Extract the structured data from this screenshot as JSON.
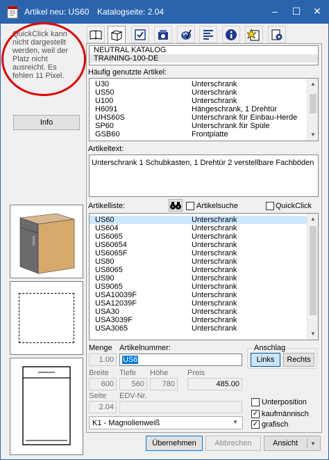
{
  "window": {
    "title": "Artikel neu: US60",
    "catalog_page": "Katalogseite: 2.04",
    "minimize": "–",
    "maximize": "☐",
    "close": "✕"
  },
  "left": {
    "quickclick_message": "QuickClick kann nicht dargestellt werden, weil der Platz nicht ausreicht. Es fehlen 11 Pixel.",
    "info_button": "Info"
  },
  "toolbar": {
    "icons": [
      "book-icon",
      "cube-icon",
      "checkbox-icon",
      "machine-icon",
      "palette-icon",
      "text-align-icon",
      "info-icon",
      "star-note-icon",
      "gear-doc-icon"
    ]
  },
  "catalog": {
    "items": [
      "NEUTRAL KATALOG",
      "TRAINING-100-DE"
    ]
  },
  "frequent": {
    "label": "Häufig genutzte Artikel:",
    "rows": [
      {
        "code": "U30",
        "desc": "Unterschrank"
      },
      {
        "code": "US50",
        "desc": "Unterschrank"
      },
      {
        "code": "U100",
        "desc": "Unterschrank"
      },
      {
        "code": "H6091",
        "desc": "Hängeschrank, 1 Drehtür"
      },
      {
        "code": "UHS60S",
        "desc": "Unterschrank für Einbau-Herde"
      },
      {
        "code": "SP60",
        "desc": "Unterschrank für Spüle"
      },
      {
        "code": "GSB60",
        "desc": "Frontplatte"
      }
    ]
  },
  "article_text": {
    "label": "Artikeltext:",
    "value": "Unterschrank 1 Schubkasten, 1 Drehtür 2 verstellbare Fachböden"
  },
  "article_list": {
    "label": "Artikelliste:",
    "search_label": "Artikelsuche",
    "quickclick_label": "QuickClick",
    "rows": [
      {
        "code": "US60",
        "desc": "Unterschrank"
      },
      {
        "code": "US604",
        "desc": "Unterschrank"
      },
      {
        "code": "US6065",
        "desc": "Unterschrank"
      },
      {
        "code": "US60654",
        "desc": "Unterschrank"
      },
      {
        "code": "US6065F",
        "desc": "Unterschrank"
      },
      {
        "code": "US80",
        "desc": "Unterschrank"
      },
      {
        "code": "US8065",
        "desc": "Unterschrank"
      },
      {
        "code": "US90",
        "desc": "Unterschrank"
      },
      {
        "code": "US9065",
        "desc": "Unterschrank"
      },
      {
        "code": "USA10039F",
        "desc": "Unterschrank"
      },
      {
        "code": "USA12039F",
        "desc": "Unterschrank"
      },
      {
        "code": "USA30",
        "desc": "Unterschrank"
      },
      {
        "code": "USA3039F",
        "desc": "Unterschrank"
      },
      {
        "code": "USA3065",
        "desc": "Unterschrank"
      }
    ]
  },
  "form": {
    "menge_label": "Menge",
    "menge_value": "1.00",
    "artikelnummer_label": "Artikelnummer:",
    "artikelnummer_value": "US6",
    "anschlag_label": "Anschlag",
    "links_label": "Links",
    "rechts_label": "Rechts",
    "breite_label": "Breite",
    "breite_value": "600",
    "tiefe_label": "Tiefe",
    "tiefe_value": "560",
    "hoehe_label": "Höhe",
    "hoehe_value": "780",
    "preis_label": "Preis",
    "preis_value": "485.00",
    "seite_label": "Seite",
    "seite_value": "2.04",
    "edv_label": "EDV-Nr.",
    "edv_value": "",
    "dropdown_value": "K1 - Magnolienweiß",
    "unterposition_label": "Unterposition",
    "kaufmaennisch_label": "kaufmännisch",
    "grafisch_label": "grafisch"
  },
  "footer": {
    "uebernehmen": "Übernehmen",
    "abbrechen": "Abbrechen",
    "ansicht": "Ansicht"
  }
}
